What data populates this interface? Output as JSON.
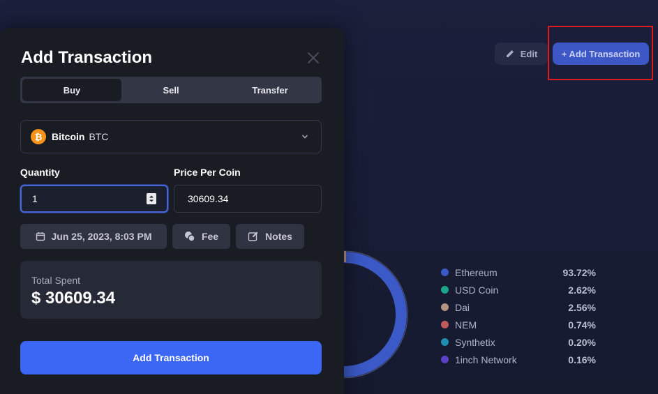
{
  "header": {
    "edit_label": "Edit",
    "add_transaction_label": "+ Add Transaction"
  },
  "allocation": {
    "items": [
      {
        "name": "Ethereum",
        "percent": "93.72%",
        "color": "#3b59c7"
      },
      {
        "name": "USD Coin",
        "percent": "2.62%",
        "color": "#1aa589"
      },
      {
        "name": "Dai",
        "percent": "2.56%",
        "color": "#b49380"
      },
      {
        "name": "NEM",
        "percent": "0.74%",
        "color": "#c05a5a"
      },
      {
        "name": "Synthetix",
        "percent": "0.20%",
        "color": "#1f8fb0"
      },
      {
        "name": "1inch Network",
        "percent": "0.16%",
        "color": "#5b3fc4"
      }
    ]
  },
  "modal": {
    "title": "Add Transaction",
    "tabs": [
      {
        "label": "Buy",
        "active": true
      },
      {
        "label": "Sell",
        "active": false
      },
      {
        "label": "Transfer",
        "active": false
      }
    ],
    "coin": {
      "icon": "bitcoin-icon",
      "name": "Bitcoin",
      "symbol": "BTC"
    },
    "quantity_label": "Quantity",
    "quantity_value": "1",
    "price_label": "Price Per Coin",
    "price_value": "30609.34",
    "date_label": "Jun 25, 2023, 8:03 PM",
    "fee_label": "Fee",
    "notes_label": "Notes",
    "total_label": "Total Spent",
    "total_value": "$ 30609.34",
    "submit_label": "Add Transaction"
  }
}
